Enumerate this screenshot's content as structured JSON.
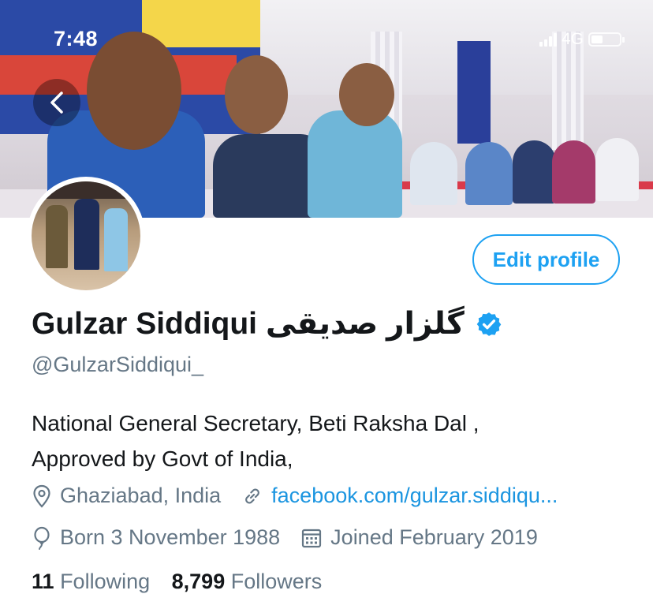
{
  "status_bar": {
    "time": "7:48",
    "network": "4G"
  },
  "profile": {
    "display_name": "Gulzar Siddiqui گلزار صدیقی",
    "handle": "@GulzarSiddiqui_",
    "verified_icon": "verified-badge-icon",
    "edit_button_label": "Edit profile",
    "bio_line1": "National General Secretary, Beti Raksha Dal ,",
    "bio_line2": "Approved by Govt of India,",
    "location": "Ghaziabad, India",
    "website": "facebook.com/gulzar.siddiqu...",
    "birthday": "Born 3 November 1988",
    "joined": "Joined February 2019",
    "following_count": "11",
    "following_label": "Following",
    "followers_count": "8,799",
    "followers_label": "Followers"
  },
  "colors": {
    "accent": "#1da1f2",
    "link": "#1b95e0",
    "secondary_text": "#657786"
  }
}
